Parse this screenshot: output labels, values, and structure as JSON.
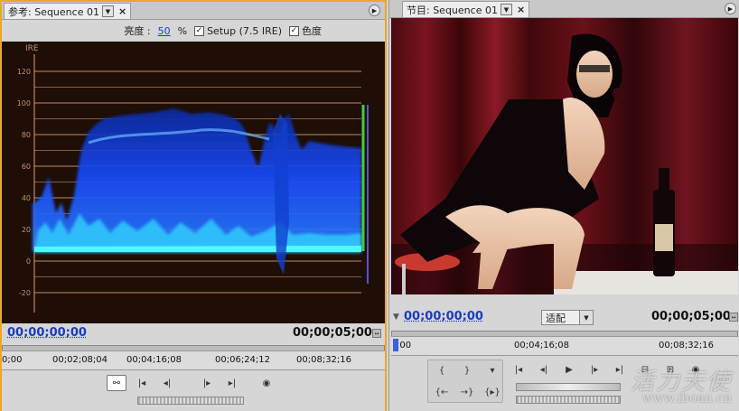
{
  "left_panel": {
    "tab_title": "参考: Sequence 01",
    "toolbar": {
      "brightness_label": "亮度 :",
      "brightness_value": "50",
      "brightness_unit": "%",
      "setup_label": "Setup (7.5 IRE)",
      "setup_checked": true,
      "chroma_label": "色度",
      "chroma_checked": true
    },
    "scope": {
      "axis_title": "IRE",
      "ticks": [
        "120",
        "100",
        "80",
        "60",
        "40",
        "20",
        "0",
        "-20"
      ]
    },
    "timecode_current": "00;00;00;00",
    "timecode_duration": "00;00;05;00",
    "ruler_labels": [
      "0;00",
      "00;02;08;04",
      "00;04;16;08",
      "00;06;24;12",
      "00;08;32;16"
    ]
  },
  "right_panel": {
    "tab_title": "节目: Sequence 01",
    "timecode_current": "00;00;00;00",
    "fit_select": "适配",
    "timecode_duration": "00;00;05;00",
    "ruler_labels": [
      ";00",
      "00;04;16;08",
      "00;08;32;16"
    ]
  },
  "watermark": {
    "text": "活力天使",
    "url": "www.iboan.cn"
  },
  "colors": {
    "accent_border": "#e8a828",
    "timecode_blue": "#1a3cc0",
    "scope_bg": "#1e0e05",
    "ire_line": "#e0a070",
    "wave_blue": "#1a4dff",
    "wave_cyan": "#33e0ff"
  }
}
